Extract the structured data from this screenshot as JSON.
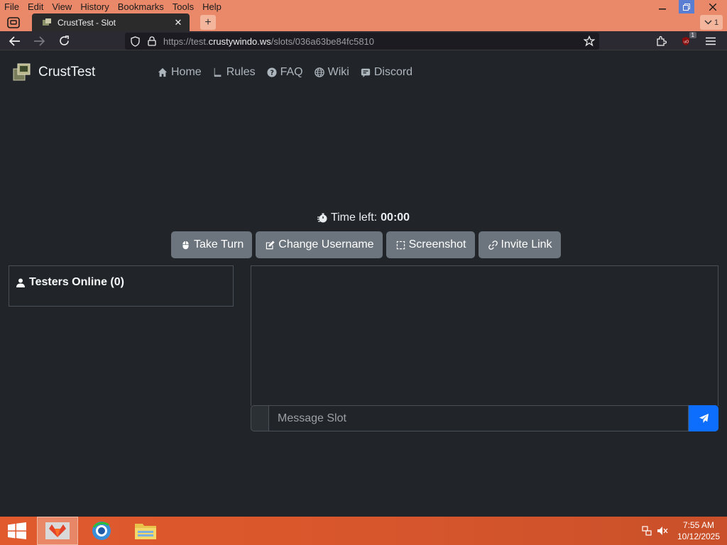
{
  "browser": {
    "menu": [
      "File",
      "Edit",
      "View",
      "History",
      "Bookmarks",
      "Tools",
      "Help"
    ],
    "tab_title": "CrustTest - Slot",
    "tab_count": "1",
    "url_prefix": "https://test.",
    "url_host": "crustywindo.ws",
    "url_path": "/slots/036a63be84fc5810",
    "extension_badge": "1"
  },
  "site": {
    "brand": "CrustTest",
    "nav": [
      {
        "label": "Home",
        "icon": "home-icon"
      },
      {
        "label": "Rules",
        "icon": "book-icon"
      },
      {
        "label": "FAQ",
        "icon": "question-icon"
      },
      {
        "label": "Wiki",
        "icon": "globe-icon"
      },
      {
        "label": "Discord",
        "icon": "discord-icon"
      }
    ]
  },
  "main": {
    "timer_label": "Time left:",
    "timer_value": "00:00",
    "buttons": [
      {
        "label": "Take Turn",
        "icon": "mouse-icon"
      },
      {
        "label": "Change Username",
        "icon": "edit-icon"
      },
      {
        "label": "Screenshot",
        "icon": "screenshot-icon"
      },
      {
        "label": "Invite Link",
        "icon": "link-icon"
      }
    ],
    "testers_title": "Testers Online (0)",
    "message_placeholder": "Message Slot"
  },
  "taskbar": {
    "time": "7:55 AM",
    "date": "10/12/2025"
  },
  "colors": {
    "page_bg": "#212529",
    "primary": "#0d6efd",
    "secondary_btn": "#6c757d",
    "chrome_accent": "#e9896a"
  }
}
